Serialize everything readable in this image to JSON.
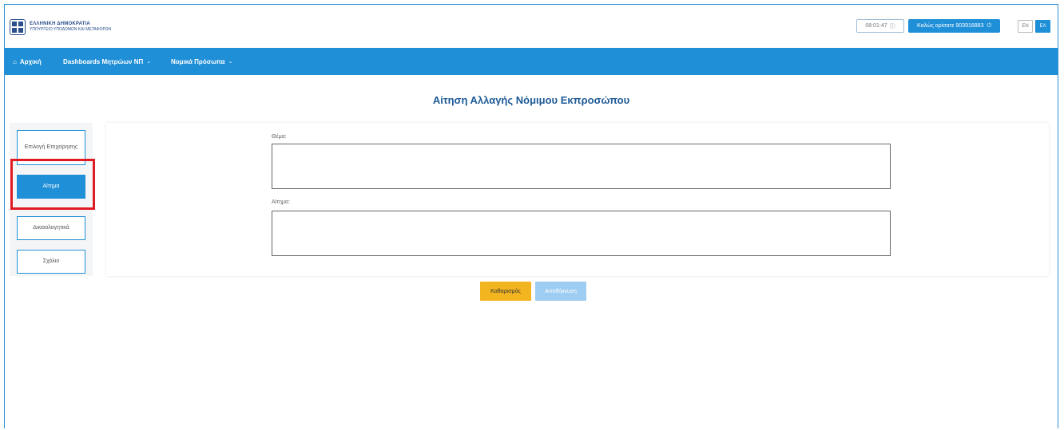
{
  "header": {
    "logo_line1": "ΕΛΛΗΝΙΚΗ ΔΗΜΟΚΡΑΤΙΑ",
    "logo_line2": "ΥΠΟΥΡΓΕΙΟ ΥΠΟΔΟΜΩΝ ΚΑΙ ΜΕΤΑΦΟΡΩΝ",
    "timer": "08:01:47",
    "welcome": "Καλώς ορίσατε 903916883",
    "lang_en": "EN",
    "lang_el": "ΕΛ"
  },
  "nav": {
    "home": "Αρχική",
    "dashboards": "Dashboards Μητρώων ΝΠ",
    "legal_entities": "Νομικά Πρόσωπα"
  },
  "page": {
    "title": "Αίτηση Αλλαγής Νόμιμου Εκπροσώπου"
  },
  "steps": [
    {
      "label": "Επιλογή Επιχείρησης"
    },
    {
      "label": "Αίτημα"
    },
    {
      "label": "Δικαιολογητικά"
    },
    {
      "label": "Σχόλιο"
    }
  ],
  "form": {
    "subject_label": "Θέμα:",
    "request_label": "Αίτημα:",
    "subject_value": "",
    "request_value": ""
  },
  "buttons": {
    "clear": "Καθαρισμός",
    "save": "Αποθήκευση"
  },
  "colors": {
    "primary": "#1f8fd8",
    "title": "#1d5a96",
    "warning": "#f3b51f",
    "highlight": "#e01b24"
  }
}
